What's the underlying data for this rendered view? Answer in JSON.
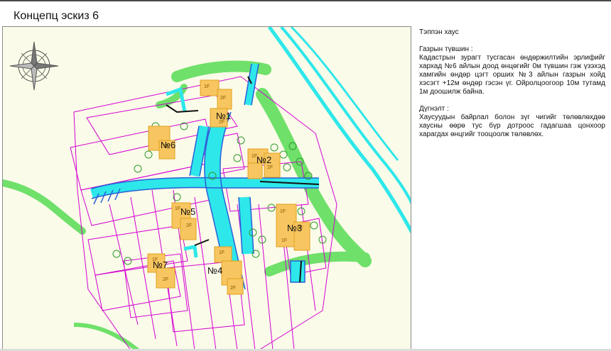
{
  "page": {
    "title": "Концепц эскиз 6"
  },
  "sidebar": {
    "heading": "Тэппэн хаус",
    "section1_title": "Газрын түвшин :",
    "section1_body": "Кадастрын зурагт тусгасан өндөржилтийн эрлифийг хархад №6 айлын доод өнцөгийг 0м түвшин гэж үзэхэд хамгийн өндөр цэгт орших №3 айлын газрын хойд хэсэгт +12м өндөр гэсэн үг. Ойролцоогоор 10м тутамд 1м доошилж байна.",
    "section2_title": "Дүгнэлт :",
    "section2_body": "Хаусуудын байрлал болон зүг чигийг төлөвлөхдөө хаусны өөрө тус бүр дотроос гадагшаа цонхоор харагдах өнцгийг тооцоолж төлөвлөх."
  },
  "plan": {
    "units": [
      {
        "label": "№1"
      },
      {
        "label": "№2"
      },
      {
        "label": "№3"
      },
      {
        "label": "№4"
      },
      {
        "label": "№5"
      },
      {
        "label": "№6"
      },
      {
        "label": "№7"
      }
    ],
    "floor_tags": {
      "first": "1F",
      "second": "2F"
    },
    "colors": {
      "paper": "#fbfbe9",
      "green": "#6fe06a",
      "cyan": "#2ee7ea",
      "blue": "#2a5fd8",
      "magenta": "#d400d4",
      "house": "#f7c660",
      "house_edge": "#e0a020"
    },
    "icons": [
      "compass-rose-icon"
    ]
  }
}
